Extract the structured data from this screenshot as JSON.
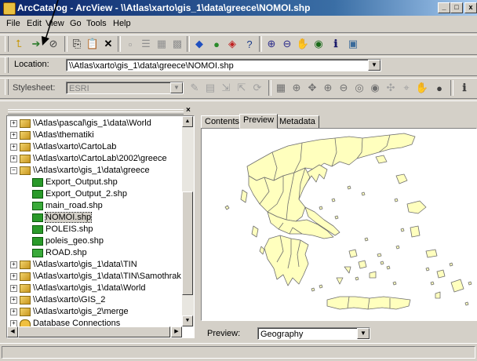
{
  "window": {
    "title": "ArcCatalog - ArcView - \\\\Atlas\\xarto\\gis_1\\data\\greece\\NOMOI.shp",
    "minimize_label": "_",
    "maximize_label": "□",
    "close_label": "x"
  },
  "menu": [
    "File",
    "Edit",
    "View",
    "Go",
    "Tools",
    "Help"
  ],
  "location": {
    "label": "Location:",
    "value": "\\\\Atlas\\xarto\\gis_1\\data\\greece\\NOMOI.shp"
  },
  "stylesheet": {
    "label": "Stylesheet:",
    "value": "ESRI"
  },
  "tree": [
    {
      "label": "\\\\Atlas\\pascal\\gis_1\\data\\World",
      "type": "folder",
      "expander": "+"
    },
    {
      "label": "\\\\Atlas\\thematiki",
      "type": "folder",
      "expander": "+"
    },
    {
      "label": "\\\\Atlas\\xarto\\CartoLab",
      "type": "folder",
      "expander": "+"
    },
    {
      "label": "\\\\Atlas\\xarto\\CartoLab\\2002\\greece",
      "type": "folder",
      "expander": "+"
    },
    {
      "label": "\\\\Atlas\\xarto\\gis_1\\data\\greece",
      "type": "folder",
      "expander": "−"
    },
    {
      "label": "Export_Output.shp",
      "type": "shapefile",
      "expander": ""
    },
    {
      "label": "Export_Output_2.shp",
      "type": "shapefile",
      "expander": ""
    },
    {
      "label": "main_road.shp",
      "type": "line",
      "expander": ""
    },
    {
      "label": "NOMOI.shp",
      "type": "shapefile",
      "expander": "",
      "selected": true
    },
    {
      "label": "POLEIS.shp",
      "type": "shapefile",
      "expander": ""
    },
    {
      "label": "poleis_geo.shp",
      "type": "shapefile",
      "expander": ""
    },
    {
      "label": "ROAD.shp",
      "type": "line",
      "expander": ""
    },
    {
      "label": "\\\\Atlas\\xarto\\gis_1\\data\\TIN",
      "type": "folder",
      "expander": "+"
    },
    {
      "label": "\\\\Atlas\\xarto\\gis_1\\data\\TIN\\Samothrak",
      "type": "folder",
      "expander": "+"
    },
    {
      "label": "\\\\Atlas\\xarto\\gis_1\\data\\World",
      "type": "folder",
      "expander": "+"
    },
    {
      "label": "\\\\Atlas\\xarto\\GIS_2",
      "type": "folder",
      "expander": "+"
    },
    {
      "label": "\\\\Atlas\\xarto\\gis_2\\merge",
      "type": "folder",
      "expander": "+"
    },
    {
      "label": "Database Connections",
      "type": "database",
      "expander": "+"
    }
  ],
  "tabs": [
    "Contents",
    "Preview",
    "Metadata"
  ],
  "preview": {
    "label": "Preview:",
    "value": "Geography"
  },
  "colors": {
    "map_fill": "#ffffbe",
    "map_stroke": "#6e6e6e"
  }
}
